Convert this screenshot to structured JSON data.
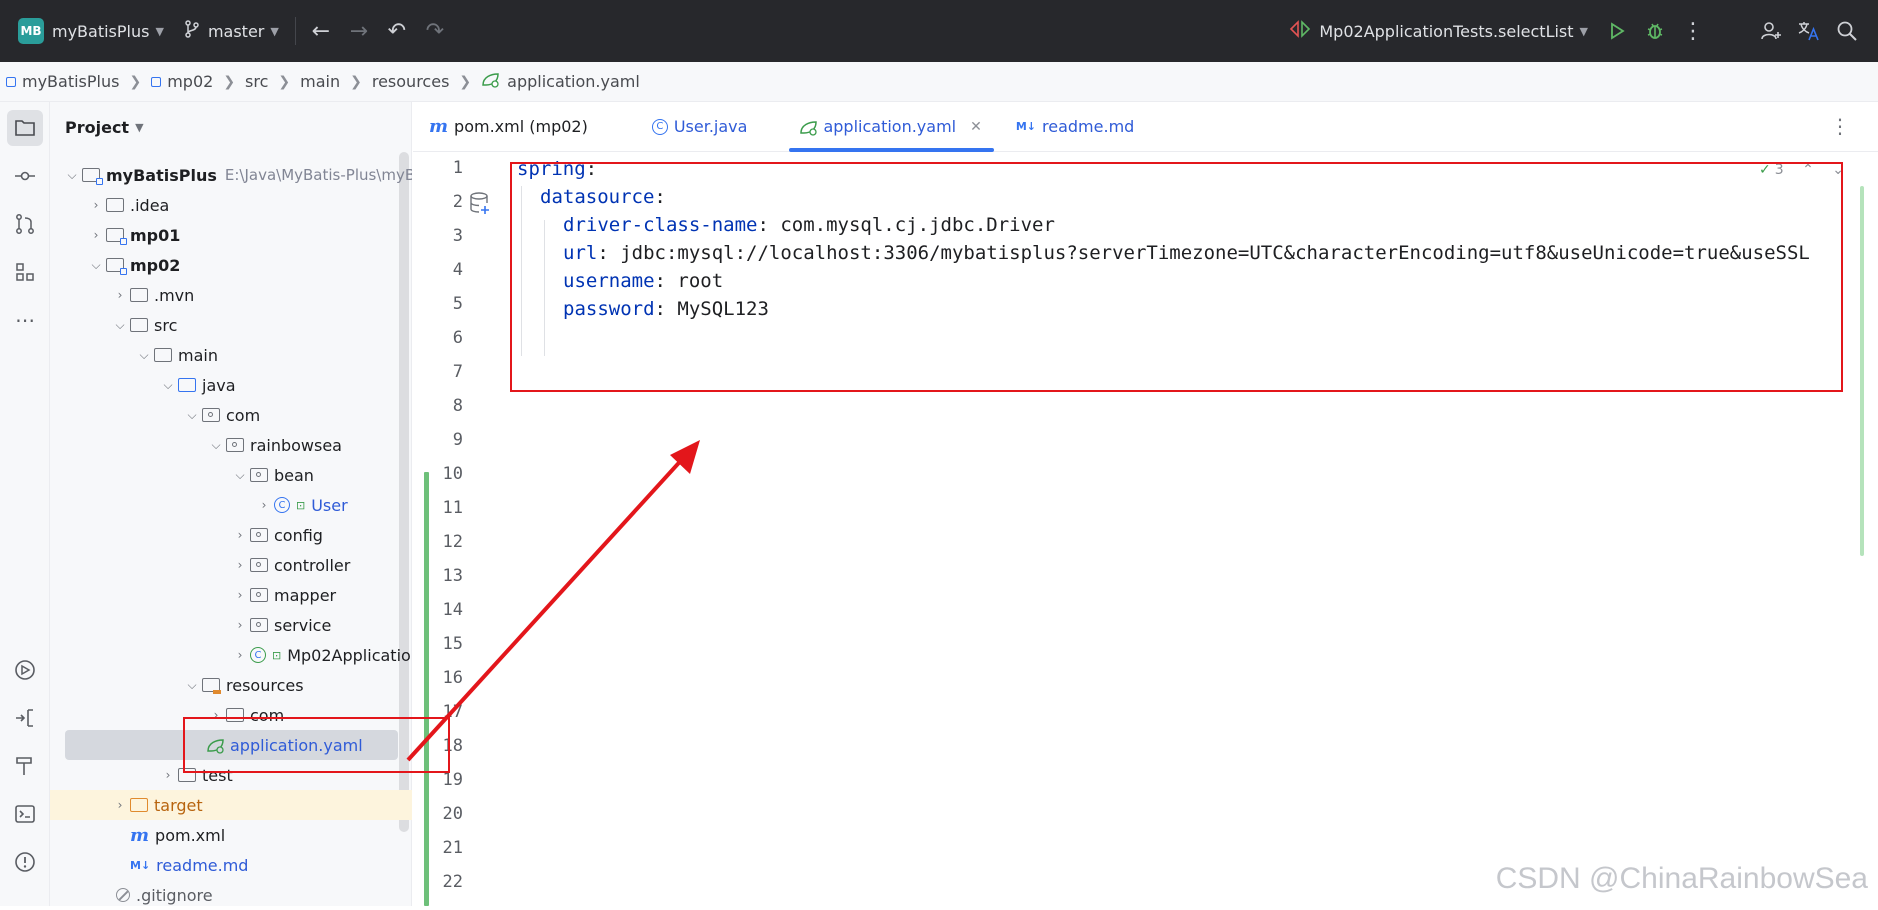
{
  "titlebar": {
    "project_badge": "MB",
    "project_name": "myBatisPlus",
    "branch": "master",
    "run_config": "Mp02ApplicationTests.selectList"
  },
  "breadcrumb": [
    "myBatisPlus",
    "mp02",
    "src",
    "main",
    "resources",
    "application.yaml"
  ],
  "project_panel": {
    "title": "Project",
    "tree": [
      {
        "label": "myBatisPlus",
        "path": "E:\\Java\\MyBatis-Plus\\myBatis"
      },
      {
        "label": ".idea"
      },
      {
        "label": "mp01"
      },
      {
        "label": "mp02"
      },
      {
        "label": ".mvn"
      },
      {
        "label": "src"
      },
      {
        "label": "main"
      },
      {
        "label": "java"
      },
      {
        "label": "com"
      },
      {
        "label": "rainbowsea"
      },
      {
        "label": "bean"
      },
      {
        "label": "User"
      },
      {
        "label": "config"
      },
      {
        "label": "controller"
      },
      {
        "label": "mapper"
      },
      {
        "label": "service"
      },
      {
        "label": "Mp02Applicatio"
      },
      {
        "label": "resources"
      },
      {
        "label": "com"
      },
      {
        "label": "application.yaml"
      },
      {
        "label": "test"
      },
      {
        "label": "target"
      },
      {
        "label": "pom.xml"
      },
      {
        "label": "readme.md"
      },
      {
        "label": ".gitignore"
      }
    ]
  },
  "tabs": [
    {
      "label": "pom.xml (mp02)",
      "icon": "maven-icon"
    },
    {
      "label": "User.java",
      "icon": "class-icon"
    },
    {
      "label": "application.yaml",
      "icon": "spring-yaml-icon",
      "active": true
    },
    {
      "label": "readme.md",
      "icon": "markdown-icon"
    }
  ],
  "editor": {
    "line_numbers": [
      "1",
      "2",
      "3",
      "4",
      "5",
      "6",
      "7",
      "8",
      "9",
      "10",
      "11",
      "12",
      "13",
      "14",
      "15",
      "16",
      "17",
      "18",
      "19",
      "20",
      "21",
      "22"
    ],
    "lines": [
      {
        "key": "spring",
        "sep": ":",
        "value": ""
      },
      {
        "key": "datasource",
        "sep": ":",
        "value": ""
      },
      {
        "key": "driver-class-name",
        "sep": ": ",
        "value": "com.mysql.cj.jdbc.Driver"
      },
      {
        "key": "url",
        "sep": ": ",
        "value": "jdbc:mysql://localhost:3306/mybatisplus?serverTimezone=UTC&characterEncoding=utf8&useUnicode=true&useSSL"
      },
      {
        "key": "username",
        "sep": ": ",
        "value": "root"
      },
      {
        "key": "password",
        "sep": ": ",
        "value": "MySQL123"
      }
    ],
    "inspection_count": "3"
  },
  "watermark": "CSDN @ChinaRainbowSea",
  "colors": {
    "titlebar_bg": "#27282c",
    "accent": "#3574f0",
    "annotation_red": "#e3161b",
    "yaml_key": "#0033b3",
    "vcs_added": "#6ec07a"
  }
}
